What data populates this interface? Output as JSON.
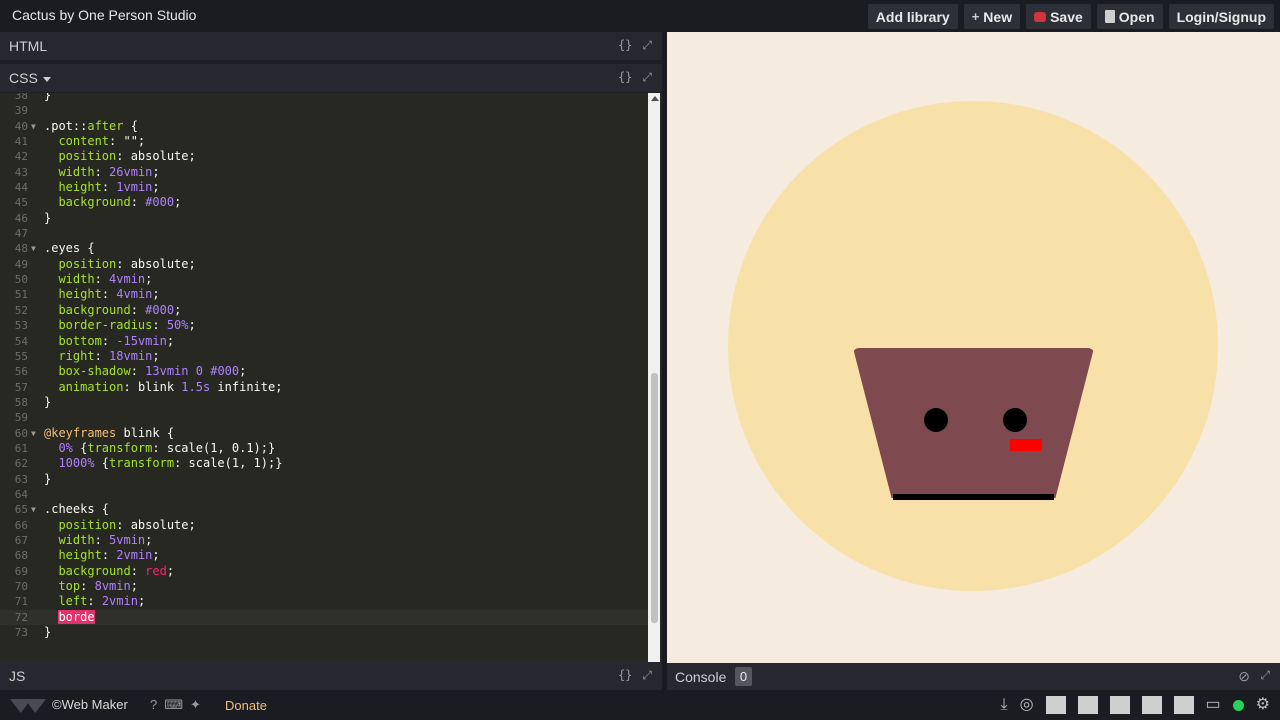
{
  "app": {
    "title": "Cactus by One Person Studio"
  },
  "toolbar": {
    "add_library": "Add library",
    "new": "New",
    "new_icon": "plus-icon",
    "save": "Save",
    "save_icon": "save-icon",
    "open": "Open",
    "open_icon": "document-icon",
    "login": "Login/Signup"
  },
  "panes": {
    "html_label": "HTML",
    "css_label": "CSS",
    "js_label": "JS",
    "controls_glyph": "{}",
    "expand_glyph": "⤢"
  },
  "editor": {
    "language": "css",
    "current_line": 72,
    "lines": [
      {
        "n": "38",
        "t": "}"
      },
      {
        "n": "39",
        "t": ""
      },
      {
        "n": "40",
        "t": ".pot::after {",
        "fold": true
      },
      {
        "n": "41",
        "t": "  content: \"\";"
      },
      {
        "n": "42",
        "t": "  position: absolute;"
      },
      {
        "n": "43",
        "t": "  width: 26vmin;"
      },
      {
        "n": "44",
        "t": "  height: 1vmin;"
      },
      {
        "n": "45",
        "t": "  background: #000;"
      },
      {
        "n": "46",
        "t": "}"
      },
      {
        "n": "47",
        "t": ""
      },
      {
        "n": "48",
        "t": ".eyes {",
        "fold": true
      },
      {
        "n": "49",
        "t": "  position: absolute;"
      },
      {
        "n": "50",
        "t": "  width: 4vmin;"
      },
      {
        "n": "51",
        "t": "  height: 4vmin;"
      },
      {
        "n": "52",
        "t": "  background: #000;"
      },
      {
        "n": "53",
        "t": "  border-radius: 50%;"
      },
      {
        "n": "54",
        "t": "  bottom: -15vmin;"
      },
      {
        "n": "55",
        "t": "  right: 18vmin;"
      },
      {
        "n": "56",
        "t": "  box-shadow: 13vmin 0 #000;"
      },
      {
        "n": "57",
        "t": "  animation: blink 1.5s infinite;"
      },
      {
        "n": "58",
        "t": "}"
      },
      {
        "n": "59",
        "t": ""
      },
      {
        "n": "60",
        "t": "@keyframes blink {",
        "fold": true
      },
      {
        "n": "61",
        "t": "  0% {transform: scale(1, 0.1);}"
      },
      {
        "n": "62",
        "t": "  1000% {transform: scale(1, 1);}"
      },
      {
        "n": "63",
        "t": "}"
      },
      {
        "n": "64",
        "t": ""
      },
      {
        "n": "65",
        "t": ".cheeks {",
        "fold": true
      },
      {
        "n": "66",
        "t": "  position: absolute;"
      },
      {
        "n": "67",
        "t": "  width: 5vmin;"
      },
      {
        "n": "68",
        "t": "  height: 2vmin;"
      },
      {
        "n": "69",
        "t": "  background: red;"
      },
      {
        "n": "70",
        "t": "  top: 8vmin;"
      },
      {
        "n": "71",
        "t": "  left: 2vmin;"
      },
      {
        "n": "72",
        "t": "  borde"
      },
      {
        "n": "73",
        "t": "}"
      }
    ]
  },
  "console": {
    "label": "Console",
    "count": "0"
  },
  "footer": {
    "brand": "©Web Maker",
    "donate": "Donate",
    "help_icon": "help-icon",
    "keyboard_icon": "keyboard-icon",
    "twitter_icon": "twitter-icon"
  },
  "colors": {
    "preview_bg": "#f5ebde",
    "sun": "#f8e1a8",
    "pot": "#7f4a4f",
    "cheek": "#ff0000",
    "editor_bg": "#272822"
  }
}
